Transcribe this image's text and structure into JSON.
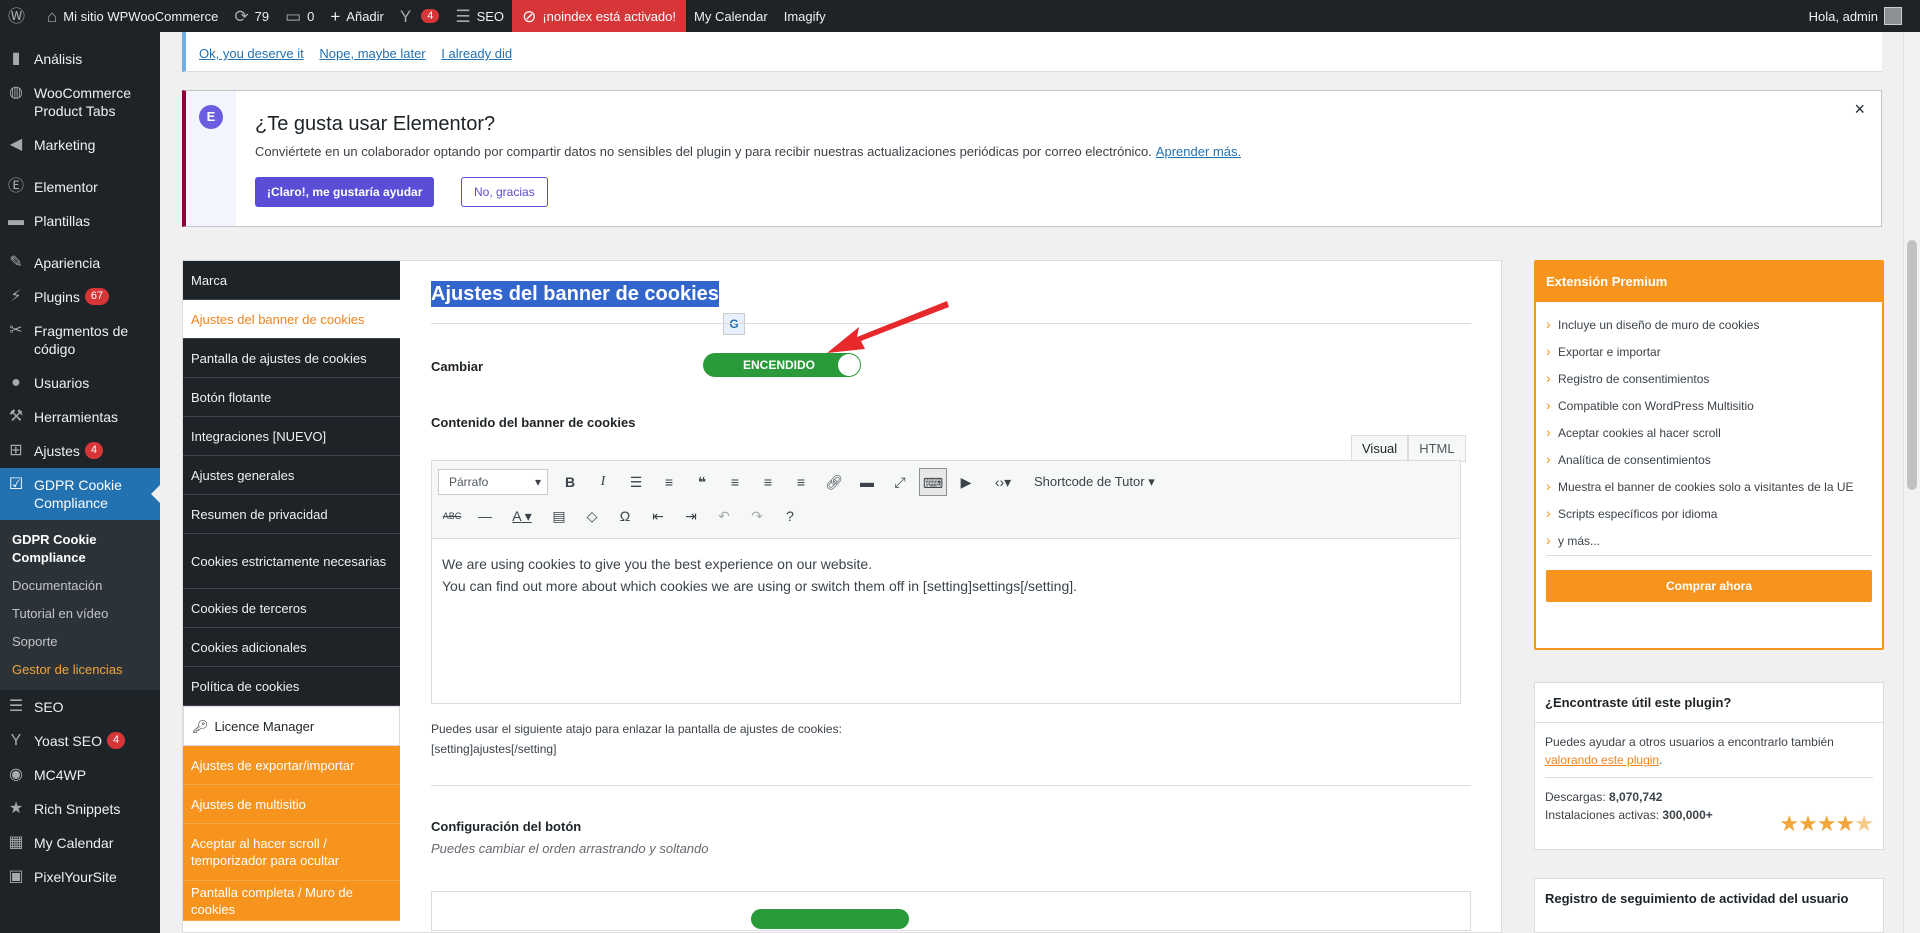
{
  "adminbar": {
    "site_name": "Mi sitio WPWooCommerce",
    "updates_count": "79",
    "comments_count": "0",
    "add_label": "Añadir",
    "yoast_count": "4",
    "seo_label": "SEO",
    "noindex_label": "¡noindex está activado!",
    "calendar_label": "My Calendar",
    "imagify_label": "Imagify",
    "greeting": "Hola, admin"
  },
  "sidemenu": {
    "items": [
      {
        "label": "Análisis",
        "icon": "bar-chart-icon"
      },
      {
        "label": "WooCommerce Product Tabs",
        "icon": "globe-icon"
      },
      {
        "label": "Marketing",
        "icon": "megaphone-icon"
      },
      {
        "label": "Elementor",
        "icon": "elementor-icon"
      },
      {
        "label": "Plantillas",
        "icon": "folder-icon"
      },
      {
        "label": "Apariencia",
        "icon": "brush-icon"
      },
      {
        "label": "Plugins",
        "icon": "plug-icon",
        "badge": "67"
      },
      {
        "label": "Fragmentos de código",
        "icon": "scissors-icon"
      },
      {
        "label": "Usuarios",
        "icon": "user-icon"
      },
      {
        "label": "Herramientas",
        "icon": "wrench-icon"
      },
      {
        "label": "Ajustes",
        "icon": "settings-icon",
        "badge": "4"
      },
      {
        "label": "GDPR Cookie Compliance",
        "icon": "checkbox-icon"
      }
    ],
    "submenu": [
      "GDPR Cookie Compliance",
      "Documentación",
      "Tutorial en vídeo",
      "Soporte",
      "Gestor de licencias"
    ],
    "items_after": [
      {
        "label": "SEO",
        "icon": "seo-icon"
      },
      {
        "label": "Yoast SEO",
        "icon": "yoast-icon",
        "badge": "4"
      },
      {
        "label": "MC4WP",
        "icon": "mc4wp-icon"
      },
      {
        "label": "Rich Snippets",
        "icon": "star-icon"
      },
      {
        "label": "My Calendar",
        "icon": "calendar-icon"
      },
      {
        "label": "PixelYourSite",
        "icon": "pixel-icon"
      }
    ]
  },
  "rating_notice": {
    "links": [
      "Ok, you deserve it",
      "Nope, maybe later",
      "I already did"
    ]
  },
  "elementor_notice": {
    "title": "¿Te gusta usar Elementor?",
    "text": "Conviértete en un colaborador optando por compartir datos no sensibles del plugin y para recibir nuestras actualizaciones periódicas por correo electrónico.",
    "link": "Aprender más.",
    "primary": "¡Claro!, me gustaría ayudar",
    "secondary": "No, gracias",
    "close": "×"
  },
  "tabs": [
    "Marca",
    "Ajustes del banner de cookies",
    "Pantalla de ajustes de cookies",
    "Botón flotante",
    "Integraciones [NUEVO]",
    "Ajustes generales",
    "Resumen de privacidad",
    "Cookies estrictamente necesarias",
    "Cookies de terceros",
    "Cookies adicionales",
    "Política de cookies",
    "Licence Manager",
    "Ajustes de exportar/importar",
    "Ajustes de multisitio",
    "Aceptar al hacer scroll / temporizador para ocultar",
    "Pantalla completa / Muro de cookies"
  ],
  "main": {
    "title": "Ajustes del banner de cookies",
    "toggle_label": "Cambiar",
    "toggle_state": "ENCENDIDO",
    "content_label": "Contenido del banner de cookies",
    "editor_tab_visual": "Visual",
    "editor_tab_html": "HTML",
    "format_select": "Párrafo",
    "shortcode": "Shortcode de Tutor",
    "editor_line1": "We are using cookies to give you the best experience on our website.",
    "editor_line2": "You can find out more about which cookies we are using or switch them off in [setting]settings[/setting].",
    "help_line1": "Puedes usar el siguiente atajo para enlazar la pantalla de ajustes de cookies:",
    "help_line2": "[setting]ajustes[/setting]",
    "button_config_label": "Configuración del botón",
    "button_config_sub": "Puedes cambiar el orden arrastrando y soltando"
  },
  "premium": {
    "title": "Extensión Premium",
    "items": [
      "Incluye un diseño de muro de cookies",
      "Exportar e importar",
      "Registro de consentimientos",
      "Compatible con WordPress Multisitio",
      "Aceptar cookies al hacer scroll",
      "Analítica de consentimientos",
      "Muestra el banner de cookies solo a visitantes de la UE",
      "Scripts específicos por idioma",
      "y más..."
    ],
    "button": "Comprar ahora"
  },
  "useful": {
    "title": "¿Encontraste útil este plugin?",
    "text": "Puedes ayudar a otros usuarios a encontrarlo también",
    "link": "valorando este plugin",
    "downloads_label": "Descargas:",
    "downloads": "8,070,742",
    "installs_label": "Instalaciones activas:",
    "installs": "300,000+",
    "rating_stars": 4.5
  },
  "activity": {
    "title": "Registro de seguimiento de actividad del usuario"
  },
  "colors": {
    "accent": "#2271b1",
    "orange": "#f7941d",
    "adminbar": "#1d2327",
    "toggle_on": "#2a9a3a",
    "elementor": "#5a4dd6"
  }
}
